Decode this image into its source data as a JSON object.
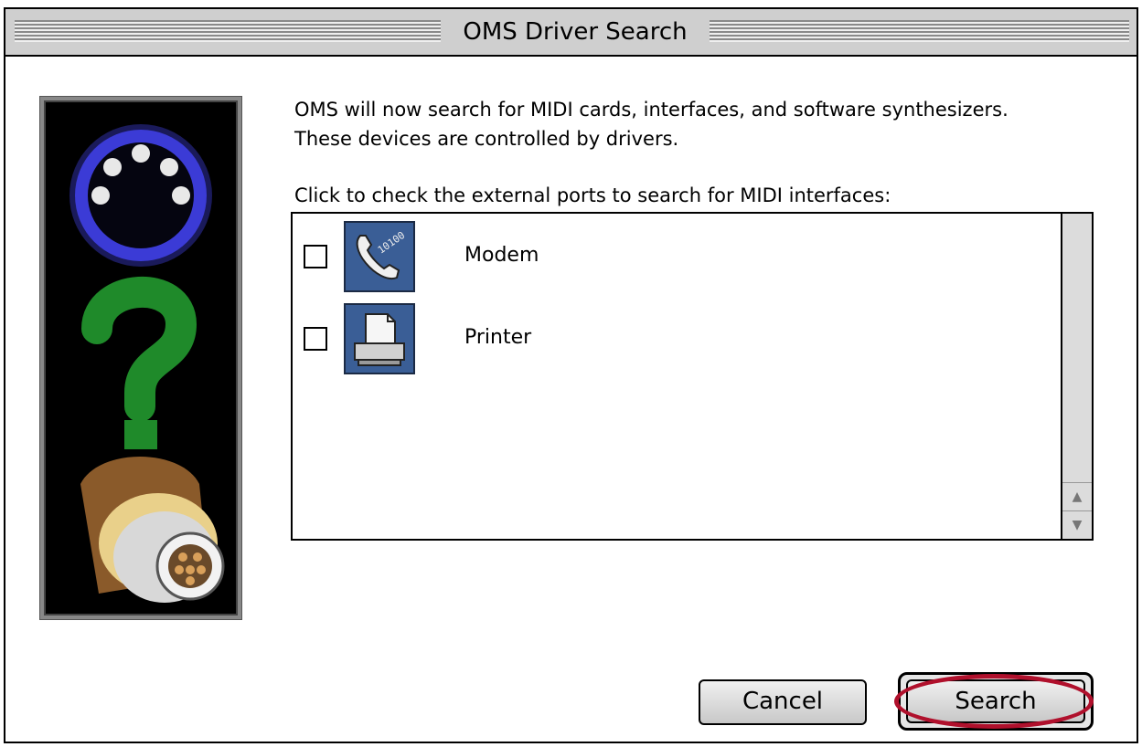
{
  "window": {
    "title": "OMS Driver Search"
  },
  "main": {
    "description": "OMS will now search for MIDI cards, interfaces, and software synthesizers. These devices are controlled by drivers.",
    "instruction": "Click to check the external ports to search for MIDI interfaces:"
  },
  "ports": [
    {
      "label": "Modem",
      "checked": false,
      "icon": "modem-phone-icon"
    },
    {
      "label": "Printer",
      "checked": false,
      "icon": "printer-icon"
    }
  ],
  "buttons": {
    "cancel": "Cancel",
    "search": "Search"
  },
  "colors": {
    "icon_bg": "#3a5e96",
    "highlight": "#b0102c",
    "midi_ring": "#3b3bd6",
    "question_mark": "#1f8a2a"
  },
  "art_icons": [
    "midi-din-connector-icon",
    "question-mark-icon",
    "midi-cable-plug-icon"
  ]
}
